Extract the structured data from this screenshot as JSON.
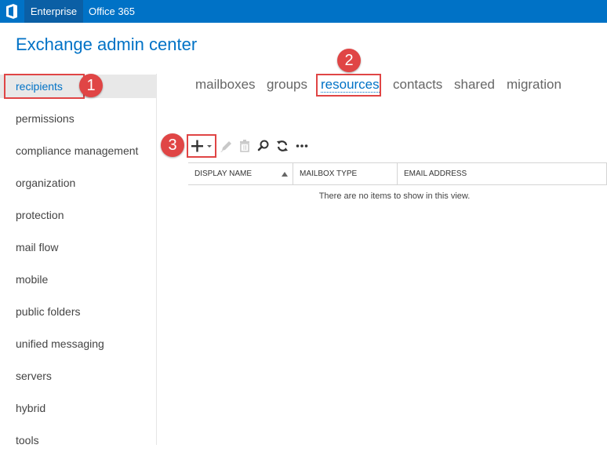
{
  "topbar": {
    "enterprise": "Enterprise",
    "office365": "Office 365"
  },
  "page_title": "Exchange admin center",
  "nav": [
    {
      "label": "recipients",
      "selected": true
    },
    {
      "label": "permissions"
    },
    {
      "label": "compliance management"
    },
    {
      "label": "organization"
    },
    {
      "label": "protection"
    },
    {
      "label": "mail flow"
    },
    {
      "label": "mobile"
    },
    {
      "label": "public folders"
    },
    {
      "label": "unified messaging"
    },
    {
      "label": "servers"
    },
    {
      "label": "hybrid"
    },
    {
      "label": "tools"
    }
  ],
  "subtabs": [
    {
      "label": "mailboxes"
    },
    {
      "label": "groups"
    },
    {
      "label": "resources",
      "selected": true
    },
    {
      "label": "contacts"
    },
    {
      "label": "shared"
    },
    {
      "label": "migration"
    }
  ],
  "toolbar": {
    "icons": [
      "add-icon",
      "edit-icon",
      "delete-icon",
      "search-icon",
      "refresh-icon",
      "more-icon"
    ]
  },
  "table": {
    "columns": [
      "DISPLAY NAME",
      "MAILBOX TYPE",
      "EMAIL ADDRESS"
    ],
    "empty_message": "There are no items to show in this view."
  },
  "annotations": [
    "1",
    "2",
    "3"
  ],
  "colors": {
    "accent": "#0072c6",
    "annotation": "#e04545"
  }
}
